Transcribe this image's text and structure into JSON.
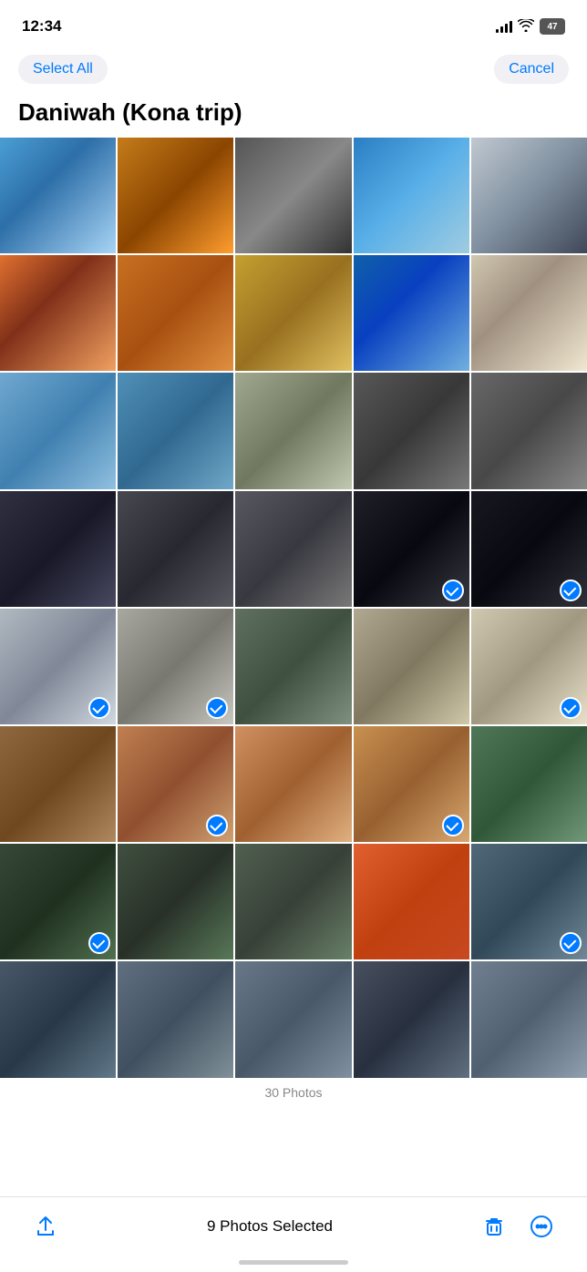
{
  "statusBar": {
    "time": "12:34",
    "battery": "47"
  },
  "header": {
    "selectAll": "Select All",
    "cancel": "Cancel",
    "albumTitle": "Daniwah (Kona trip)"
  },
  "bottomBar": {
    "selectedText": "9 Photos Selected"
  },
  "photos": [
    {
      "id": 1,
      "class": "p1",
      "selected": false
    },
    {
      "id": 2,
      "class": "p2",
      "selected": false
    },
    {
      "id": 3,
      "class": "p3",
      "selected": false
    },
    {
      "id": 4,
      "class": "p4",
      "selected": false
    },
    {
      "id": 5,
      "class": "p5",
      "selected": false
    },
    {
      "id": 6,
      "class": "p6",
      "selected": false
    },
    {
      "id": 7,
      "class": "p7",
      "selected": false
    },
    {
      "id": 8,
      "class": "p8",
      "selected": false
    },
    {
      "id": 9,
      "class": "p9",
      "selected": false
    },
    {
      "id": 10,
      "class": "p10",
      "selected": false
    },
    {
      "id": 11,
      "class": "p11",
      "selected": false
    },
    {
      "id": 12,
      "class": "p12",
      "selected": false
    },
    {
      "id": 13,
      "class": "p13",
      "selected": false
    },
    {
      "id": 14,
      "class": "p14",
      "selected": false
    },
    {
      "id": 15,
      "class": "p15",
      "selected": false
    },
    {
      "id": 16,
      "class": "p16",
      "selected": false
    },
    {
      "id": 17,
      "class": "p17",
      "selected": false
    },
    {
      "id": 18,
      "class": "p18",
      "selected": false
    },
    {
      "id": 19,
      "class": "p19",
      "selected": true
    },
    {
      "id": 20,
      "class": "p20",
      "selected": true
    },
    {
      "id": 21,
      "class": "p21",
      "selected": true
    },
    {
      "id": 22,
      "class": "p22",
      "selected": true
    },
    {
      "id": 23,
      "class": "p23",
      "selected": false
    },
    {
      "id": 24,
      "class": "p24",
      "selected": false
    },
    {
      "id": 25,
      "class": "p25",
      "selected": true
    },
    {
      "id": 26,
      "class": "p26",
      "selected": false
    },
    {
      "id": 27,
      "class": "p27",
      "selected": true
    },
    {
      "id": 28,
      "class": "p28",
      "selected": false
    },
    {
      "id": 29,
      "class": "p29",
      "selected": true
    },
    {
      "id": 30,
      "class": "p30",
      "selected": false
    },
    {
      "id": 31,
      "class": "p31",
      "selected": true
    },
    {
      "id": 32,
      "class": "p32",
      "selected": false
    },
    {
      "id": 33,
      "class": "p33",
      "selected": false
    },
    {
      "id": 34,
      "class": "p34",
      "selected": false
    },
    {
      "id": 35,
      "class": "p35",
      "selected": true
    },
    {
      "id": 36,
      "class": "p36",
      "selected": false
    },
    {
      "id": 37,
      "class": "p37",
      "selected": false
    },
    {
      "id": 38,
      "class": "p38",
      "selected": false
    },
    {
      "id": 39,
      "class": "p39",
      "selected": false
    },
    {
      "id": 40,
      "class": "p40",
      "selected": false
    }
  ],
  "photoCountHint": "30 Photos"
}
